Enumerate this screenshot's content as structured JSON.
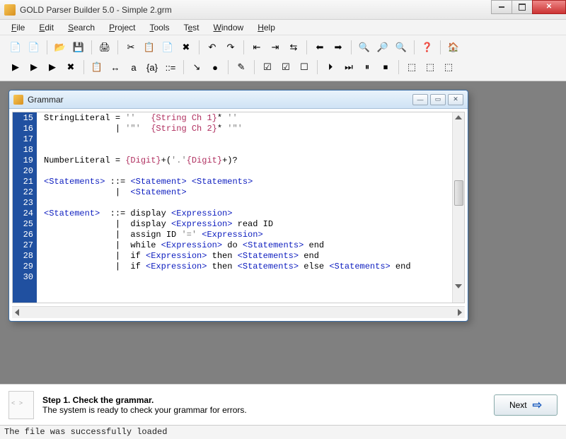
{
  "window": {
    "title": "GOLD Parser Builder 5.0 - Simple 2.grm"
  },
  "menu": {
    "file": "File",
    "edit": "Edit",
    "search": "Search",
    "project": "Project",
    "tools": "Tools",
    "test": "Test",
    "window": "Window",
    "help": "Help"
  },
  "toolbar_icons": {
    "row1": [
      "📄",
      "📄",
      "📂",
      "💾",
      "🖨",
      "✂",
      "📋",
      "📄",
      "✖",
      "↶",
      "↷",
      "⇤",
      "⇥",
      "⇆",
      "⬅",
      "➡",
      "🔍",
      "🔎",
      "🔍",
      "❓",
      "🏠"
    ],
    "row2": [
      "▶",
      "▶",
      "▶",
      "✖",
      "📋",
      "↔",
      "a",
      "{a}",
      "::=",
      "↘",
      "●",
      "✎",
      "☑",
      "☑",
      "☐",
      "⏵",
      "⏭",
      "⏸",
      "⏹",
      "⬚",
      "⬚",
      "⬚"
    ]
  },
  "child": {
    "title": "Grammar"
  },
  "editor": {
    "first_line": 15,
    "lines": [
      [
        {
          "t": "StringLiteral = ",
          "c": "tok-name"
        },
        {
          "t": "''   ",
          "c": "tok-str"
        },
        {
          "t": "{String Ch 1}",
          "c": "tok-set"
        },
        {
          "t": "* ",
          "c": "tok-op"
        },
        {
          "t": "''",
          "c": "tok-str"
        }
      ],
      [
        {
          "t": "              | ",
          "c": "tok-op"
        },
        {
          "t": "'\"'  ",
          "c": "tok-str"
        },
        {
          "t": "{String Ch 2}",
          "c": "tok-set"
        },
        {
          "t": "* ",
          "c": "tok-op"
        },
        {
          "t": "'\"'",
          "c": "tok-str"
        }
      ],
      [],
      [],
      [
        {
          "t": "NumberLiteral = ",
          "c": "tok-name"
        },
        {
          "t": "{Digit}",
          "c": "tok-set"
        },
        {
          "t": "+(",
          "c": "tok-op"
        },
        {
          "t": "'.'",
          "c": "tok-str"
        },
        {
          "t": "{Digit}",
          "c": "tok-set"
        },
        {
          "t": "+)?",
          "c": "tok-op"
        }
      ],
      [],
      [
        {
          "t": "<Statements>",
          "c": "tok-nt"
        },
        {
          "t": " ::= ",
          "c": "tok-op"
        },
        {
          "t": "<Statement>",
          "c": "tok-nt"
        },
        {
          "t": " ",
          "c": ""
        },
        {
          "t": "<Statements>",
          "c": "tok-nt"
        }
      ],
      [
        {
          "t": "              |  ",
          "c": "tok-op"
        },
        {
          "t": "<Statement>",
          "c": "tok-nt"
        }
      ],
      [],
      [
        {
          "t": "<Statement>",
          "c": "tok-nt"
        },
        {
          "t": "  ::= display ",
          "c": "tok-kw"
        },
        {
          "t": "<Expression>",
          "c": "tok-nt"
        }
      ],
      [
        {
          "t": "              |  display ",
          "c": "tok-kw"
        },
        {
          "t": "<Expression>",
          "c": "tok-nt"
        },
        {
          "t": " read ID",
          "c": "tok-kw"
        }
      ],
      [
        {
          "t": "              |  assign ID ",
          "c": "tok-kw"
        },
        {
          "t": "'='",
          "c": "tok-str"
        },
        {
          "t": " ",
          "c": ""
        },
        {
          "t": "<Expression>",
          "c": "tok-nt"
        }
      ],
      [
        {
          "t": "              |  while ",
          "c": "tok-kw"
        },
        {
          "t": "<Expression>",
          "c": "tok-nt"
        },
        {
          "t": " do ",
          "c": "tok-kw"
        },
        {
          "t": "<Statements>",
          "c": "tok-nt"
        },
        {
          "t": " end",
          "c": "tok-kw"
        }
      ],
      [
        {
          "t": "              |  if ",
          "c": "tok-kw"
        },
        {
          "t": "<Expression>",
          "c": "tok-nt"
        },
        {
          "t": " then ",
          "c": "tok-kw"
        },
        {
          "t": "<Statements>",
          "c": "tok-nt"
        },
        {
          "t": " end",
          "c": "tok-kw"
        }
      ],
      [
        {
          "t": "              |  if ",
          "c": "tok-kw"
        },
        {
          "t": "<Expression>",
          "c": "tok-nt"
        },
        {
          "t": " then ",
          "c": "tok-kw"
        },
        {
          "t": "<Statements>",
          "c": "tok-nt"
        },
        {
          "t": " else ",
          "c": "tok-kw"
        },
        {
          "t": "<Statements>",
          "c": "tok-nt"
        },
        {
          "t": " end",
          "c": "tok-kw"
        }
      ],
      []
    ]
  },
  "step": {
    "title": "Step 1. Check the grammar.",
    "desc": "The system is ready to check your grammar for errors.",
    "next": "Next"
  },
  "status": "The file was successfully loaded"
}
